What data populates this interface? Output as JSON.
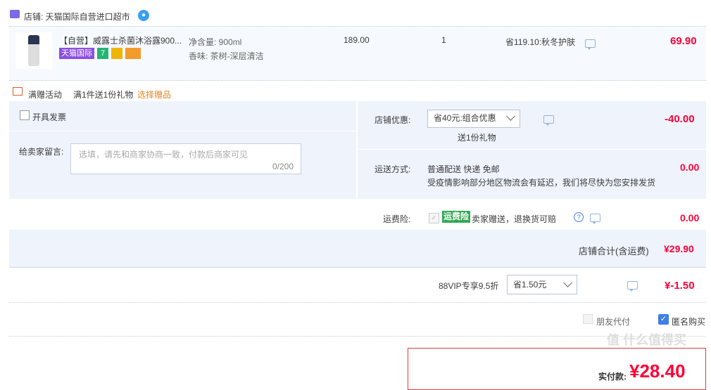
{
  "shop": {
    "label": "店铺: 天猫国际自营进口超市"
  },
  "item": {
    "title": "【自营】威露士杀菌沐浴露900...",
    "badge": "天猫国际",
    "spec_volume": "净含量: 900ml",
    "spec_scent": "香味: 茶树-深层清洁",
    "unit_price": "189.00",
    "quantity": "1",
    "promo": "省119.10:秋冬护肤",
    "subtotal": "69.90"
  },
  "gift": {
    "label": "满赠活动",
    "desc": "满1件送1份礼物",
    "link": "选择赠品"
  },
  "invoice": {
    "label": "开具发票"
  },
  "message": {
    "label": "给卖家留言:",
    "placeholder": "选填，请先和商家协商一致，付款后商家可见",
    "count": "0/200"
  },
  "store_discount": {
    "label": "店铺优惠:",
    "value": "省40元:组合优惠",
    "sub": "送1份礼物",
    "amount": "-40.00"
  },
  "shipping": {
    "label": "运送方式:",
    "method": "普通配送 快递 免邮",
    "note": "受疫情影响部分地区物流会有延迟，我们将尽快为您安排发货",
    "amount": "0.00"
  },
  "insurance": {
    "label": "运费险:",
    "tag": "运费险",
    "desc": "卖家赠送，退换货可赔",
    "amount": "0.00"
  },
  "store_total": {
    "label": "店铺合计(含运费)",
    "amount": "¥29.90"
  },
  "vip": {
    "label": "88VIP专享9.5折",
    "value": "省1.50元",
    "amount": "¥-1.50"
  },
  "options": {
    "friend_pay": "朋友代付",
    "anonymous": "匿名购买"
  },
  "pay": {
    "label": "实付款:",
    "amount": "¥28.40"
  },
  "watermark": "值 什么值得买",
  "colors": {
    "accent_red": "#ff0036",
    "panel_bg": "#eef3fc",
    "tmall_badge": "#8c4fe1",
    "gift_link": "#e8851e",
    "insurance_green": "#33a854",
    "checkbox_blue": "#3f7fe6"
  }
}
